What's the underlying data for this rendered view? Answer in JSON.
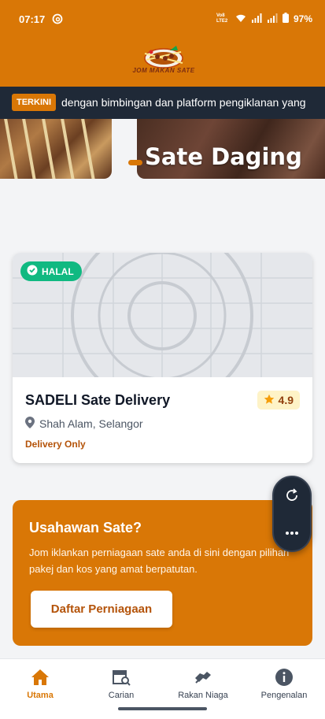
{
  "status_bar": {
    "time": "07:17",
    "network": "Vo8 LTE2",
    "battery": "97%"
  },
  "header": {
    "logo_text": "JOM MAKAN SATE"
  },
  "ticker": {
    "badge": "TERKINI",
    "text": "dengan bimbingan dan platform pengiklanan yang"
  },
  "banner": {
    "title": "Sate Daging"
  },
  "listing": {
    "halal_badge": "HALAL",
    "name": "SADELI Sate Delivery",
    "rating": "4.9",
    "location": "Shah Alam, Selangor",
    "tag": "Delivery Only"
  },
  "cta": {
    "title": "Usahawan Sate?",
    "description": "Jom iklankan perniagaan sate anda di sini dengan pilihan pakej dan kos yang amat berpatutan.",
    "button_label": "Daftar Perniagaan"
  },
  "nav": {
    "items": [
      {
        "label": "Utama",
        "icon": "home-icon",
        "active": true
      },
      {
        "label": "Carian",
        "icon": "search-store-icon",
        "active": false
      },
      {
        "label": "Rakan Niaga",
        "icon": "handshake-icon",
        "active": false
      },
      {
        "label": "Pengenalan",
        "icon": "info-icon",
        "active": false
      }
    ]
  },
  "colors": {
    "brand": "#D97706",
    "ticker_bg": "#1F2937",
    "halal": "#10B981",
    "rating_bg": "#FEF3C7"
  }
}
